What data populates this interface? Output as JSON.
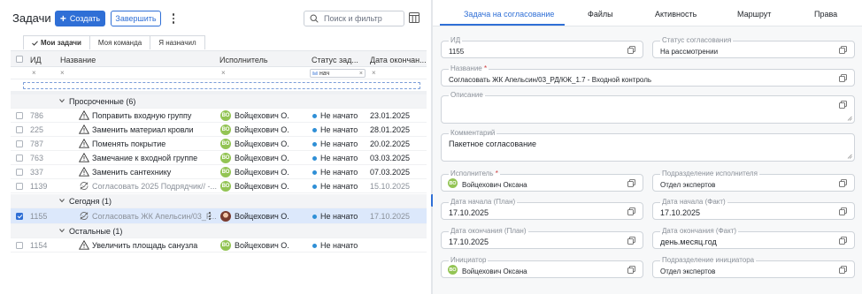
{
  "header": {
    "title": "Задачи",
    "create_label": "Создать",
    "finish_label": "Завершить",
    "search_placeholder": "Поиск и фильтр"
  },
  "filter_tabs": [
    {
      "label": "Мои задачи",
      "active": true
    },
    {
      "label": "Моя команда",
      "active": false
    },
    {
      "label": "Я назначил",
      "active": false
    }
  ],
  "columns": {
    "id": "ИД",
    "name": "Название",
    "assignee": "Исполнитель",
    "status": "Статус зад...",
    "due": "Дата окончан..."
  },
  "column_filters": {
    "clear": "×",
    "status_value": "нач"
  },
  "groups": {
    "overdue": "Просроченные (6)",
    "today": "Сегодня (1)",
    "other": "Остальные (1)"
  },
  "rows_overdue": [
    {
      "id": "786",
      "name": "Поправить входную группу",
      "assignee": "Войцехович О.",
      "initials": "ВО",
      "status": "Не начато",
      "due": "23.01.2025"
    },
    {
      "id": "225",
      "name": "Заменить материал кровли",
      "assignee": "Войцехович О.",
      "initials": "ВО",
      "status": "Не начато",
      "due": "28.01.2025"
    },
    {
      "id": "787",
      "name": "Поменять покрытие",
      "assignee": "Войцехович О.",
      "initials": "ВО",
      "status": "Не начато",
      "due": "20.02.2025"
    },
    {
      "id": "763",
      "name": "Замечание к входной группе",
      "assignee": "Войцехович О.",
      "initials": "ВО",
      "status": "Не начато",
      "due": "03.03.2025"
    },
    {
      "id": "337",
      "name": "Заменить сантехнику",
      "assignee": "Войцехович О.",
      "initials": "ВО",
      "status": "Не начато",
      "due": "07.03.2025"
    },
    {
      "id": "1139",
      "name": "Согласовать 2025 Подрядчик// -...",
      "assignee": "Войцехович О.",
      "initials": "ВО",
      "status": "Не начато",
      "due": "15.10.2025"
    }
  ],
  "rows_today": [
    {
      "id": "1155",
      "name": "Согласовать ЖК Апельсин/03_Р...",
      "assignee": "Войцехович О.",
      "status": "Не начато",
      "due": "17.10.2025"
    }
  ],
  "rows_other": [
    {
      "id": "1154",
      "name": "Увеличить площадь санузла",
      "assignee": "Войцехович О.",
      "initials": "ВО",
      "status": "Не начато",
      "due": ""
    }
  ],
  "detail_tabs": [
    {
      "label": "Задача на согласование",
      "active": true
    },
    {
      "label": "Файлы",
      "active": false
    },
    {
      "label": "Активность",
      "active": false
    },
    {
      "label": "Маршрут",
      "active": false
    },
    {
      "label": "Права",
      "active": false
    }
  ],
  "detail": {
    "id_label": "ИД",
    "id_value": "1155",
    "approval_status_label": "Статус согласования",
    "approval_status_value": "На рассмотрении",
    "name_label": "Название",
    "name_value": "Согласовать ЖК Апельсин/03_РД/КЖ_1.7 - Входной контроль",
    "description_label": "Описание",
    "description_value": "",
    "comment_label": "Комментарий",
    "comment_value": "Пакетное согласование",
    "assignee_label": "Исполнитель",
    "assignee_value": "Войцехович Оксана",
    "assignee_initials": "ВО",
    "assignee_dept_label": "Подразделение исполнителя",
    "assignee_dept_value": "Отдел экспертов",
    "start_plan_label": "Дата начала (План)",
    "start_plan_value": "17.10.2025",
    "start_fact_label": "Дата начала (Факт)",
    "start_fact_value": "17.10.2025",
    "end_plan_label": "Дата окончания (План)",
    "end_plan_value": "17.10.2025",
    "end_fact_label": "Дата окончания (Факт)",
    "end_fact_value": "день.месяц.год",
    "initiator_label": "Инициатор",
    "initiator_value": "Войцехович Оксана",
    "initiator_initials": "ВО",
    "initiator_dept_label": "Подразделение инициатора",
    "initiator_dept_value": "Отдел экспертов",
    "required_mark": "*"
  },
  "colors": {
    "accent": "#2f6fd6",
    "avatar": "#93c454",
    "status_dot": "#2f8fd6",
    "selected_row": "#dce8fb"
  }
}
